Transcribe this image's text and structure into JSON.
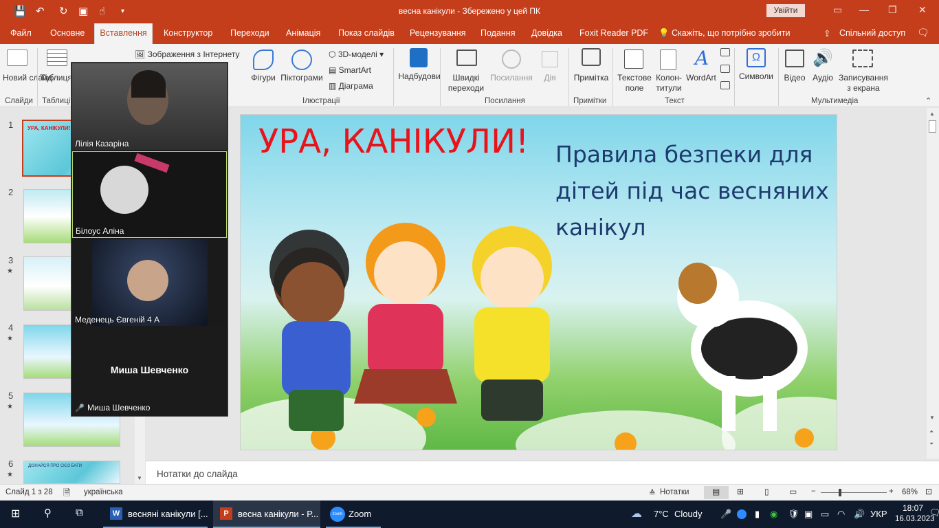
{
  "titlebar": {
    "doc_title": "весна канікули  -  Збережено у цей ПК",
    "signin": "Увійти"
  },
  "tabs": [
    "Файл",
    "Основне",
    "Вставлення",
    "Конструктор",
    "Переходи",
    "Анімація",
    "Показ слайдів",
    "Рецензування",
    "Подання",
    "Довідка",
    "Foxit Reader PDF",
    "Скажіть, що потрібно зробити",
    "Спільний доступ"
  ],
  "ribbon": {
    "new_slide": "Новий слайд",
    "table": "Таблиця",
    "internet_images": "Зображення з Інтернету",
    "shapes": "Фігури",
    "icons": "Піктограми",
    "models3d": "3D-моделі",
    "smartart": "SmartArt",
    "chart": "Діаграма",
    "addins": "Надбудови",
    "quick_transitions": "Швидкі переходи",
    "links": "Посилання",
    "action": "Дія",
    "comment": "Примітка",
    "textbox": "Текстове поле",
    "header_footer": "Колон-титули",
    "wordart": "WordArt",
    "symbols": "Символи",
    "video": "Відео",
    "audio": "Аудіо",
    "screen_recording": "Записування з екрана",
    "groups": {
      "slides": "Слайди",
      "tables": "Таблиці",
      "illustrations": "Ілюстрації",
      "links": "Посилання",
      "comments": "Примітки",
      "text": "Текст",
      "media": "Мультимедіа"
    }
  },
  "thumbnails": [
    {
      "num": "1",
      "star": "",
      "text": "УРА, КАНІКУЛИ!"
    },
    {
      "num": "2",
      "star": "",
      "text": ""
    },
    {
      "num": "3",
      "star": "★",
      "text": ""
    },
    {
      "num": "4",
      "star": "★",
      "text": ""
    },
    {
      "num": "5",
      "star": "★",
      "text": ""
    },
    {
      "num": "6",
      "star": "★",
      "text": "ДІЗНАЙСЯ ПРО СЮЗ БАГИ"
    }
  ],
  "video": {
    "participants": [
      "Лілія Казаріна",
      "Білоус Аліна",
      "Меденець Євгеній 4 А",
      "Миша Шевченко"
    ],
    "placeholder_name": "Миша Шевченко"
  },
  "slide": {
    "title": "УРА, КАНІКУЛИ!",
    "subtitle": "Правила безпеки для дітей під час весняних канікул"
  },
  "notes": {
    "placeholder": "Нотатки до слайда"
  },
  "status": {
    "slide_count": "Слайд 1 з 28",
    "language": "українська",
    "notes_btn": "Нотатки",
    "zoom": "68%"
  },
  "taskbar": {
    "apps": [
      "весняні канікули [...",
      "весна канікули - Р...",
      "Zoom"
    ],
    "weather_temp": "7°C",
    "weather_text": "Cloudy",
    "lang": "УКР",
    "time": "18:07",
    "date": "16.03.2023"
  },
  "colors": {
    "accent": "#c43e1c",
    "slide_title": "#e8141b",
    "slide_subtitle": "#1e3a6e"
  }
}
